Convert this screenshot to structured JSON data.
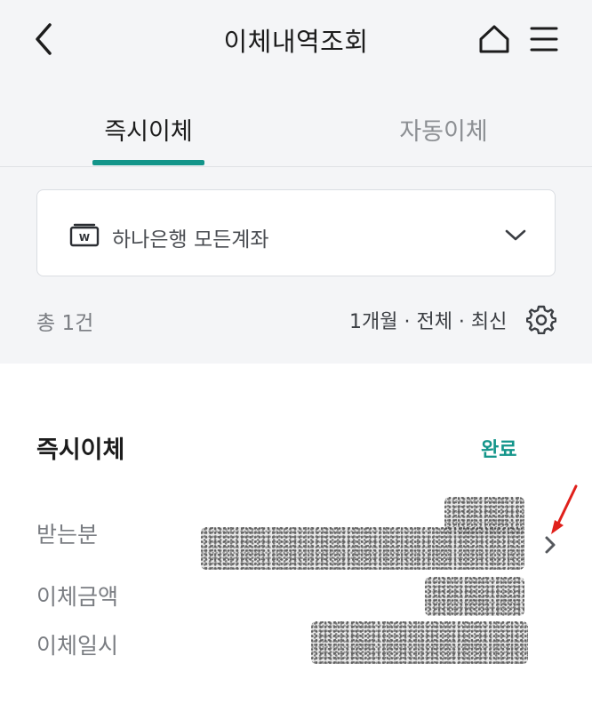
{
  "header": {
    "title": "이체내역조회",
    "back_icon": "chevron-left-icon",
    "home_icon": "home-icon",
    "menu_icon": "hamburger-menu-icon"
  },
  "tabs": [
    {
      "label": "즉시이체",
      "active": true
    },
    {
      "label": "자동이체",
      "active": false
    }
  ],
  "account_select": {
    "label": "하나은행 모든계좌",
    "icon": "wallet-icon"
  },
  "summary": {
    "total": "총 1건",
    "filter": "1개월 · 전체 · 최신",
    "settings_icon": "gear-icon"
  },
  "transfer": {
    "title": "즉시이체",
    "status": "완료",
    "labels": {
      "recipient": "받는분",
      "amount": "이체금액",
      "date": "이체일시"
    }
  },
  "colors": {
    "accent": "#13958a",
    "annotation_arrow": "#e0201b",
    "background": "#f4f5f7"
  }
}
